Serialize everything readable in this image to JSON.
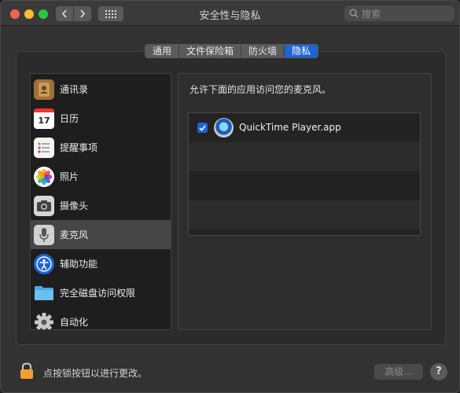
{
  "window": {
    "title": "安全性与隐私"
  },
  "search": {
    "placeholder": "搜索"
  },
  "tabs": [
    {
      "label": "通用",
      "active": false
    },
    {
      "label": "文件保险箱",
      "active": false
    },
    {
      "label": "防火墙",
      "active": false
    },
    {
      "label": "隐私",
      "active": true
    }
  ],
  "categories": [
    {
      "label": "通讯录",
      "icon": "contacts-icon"
    },
    {
      "label": "日历",
      "icon": "calendar-icon",
      "icon_text": "17"
    },
    {
      "label": "提醒事项",
      "icon": "reminders-icon"
    },
    {
      "label": "照片",
      "icon": "photos-icon"
    },
    {
      "label": "摄像头",
      "icon": "camera-icon"
    },
    {
      "label": "麦克风",
      "icon": "microphone-icon",
      "selected": true
    },
    {
      "label": "辅助功能",
      "icon": "accessibility-icon"
    },
    {
      "label": "完全磁盘访问权限",
      "icon": "folder-icon"
    },
    {
      "label": "自动化",
      "icon": "gear-icon"
    }
  ],
  "privacy": {
    "prompt": "允许下面的应用访问您的麦克风。",
    "apps": [
      {
        "name": "QuickTime Player.app",
        "checked": true,
        "icon": "quicktime-icon"
      }
    ]
  },
  "footer": {
    "lock_text": "点按锁按钮以进行更改。",
    "advanced_label": "高级...",
    "help_label": "?"
  },
  "colors": {
    "accent": "#1e64d6",
    "window_bg": "#323232",
    "list_bg": "#1e1e1e"
  }
}
